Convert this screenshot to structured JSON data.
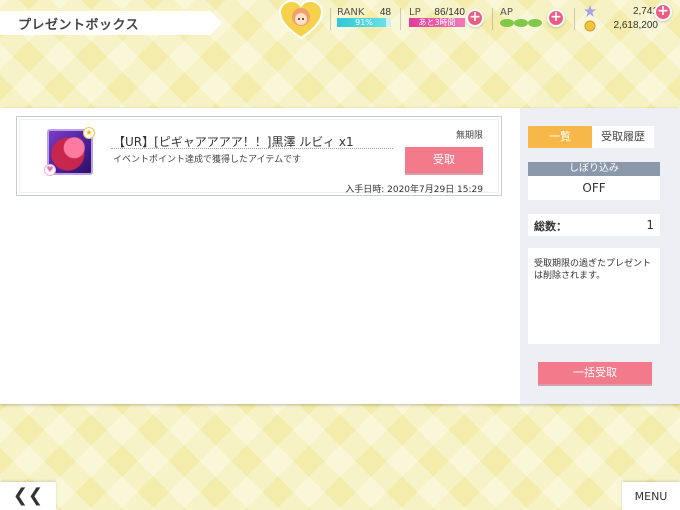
{
  "header": {
    "title": "プレゼントボックス",
    "rank": {
      "label": "RANK",
      "value": "48",
      "progress_text": "91%",
      "progress": 0.91
    },
    "lp": {
      "label": "LP",
      "value": "86/140",
      "sub": "あと3時間"
    },
    "ap": {
      "label": "AP"
    },
    "gems": {
      "stars": "2,741",
      "gold": "2,618,200"
    }
  },
  "gift_list": {
    "items": [
      {
        "title": "【UR】[ピギャアアアア！！]黒澤 ルビィ x1",
        "description": "イベントポイント達成で獲得したアイテムです",
        "expiry": "無期限",
        "receive_label": "受取",
        "date": "入手日時: 2020年7月29日 15:29"
      }
    ]
  },
  "sidebar": {
    "tabs": [
      "一覧",
      "受取履歴"
    ],
    "filter_label": "しぼり込み",
    "filter_value": "OFF",
    "count_label": "総数：",
    "count_value": "1",
    "notice": "受取期限の過ぎたプレゼントは削除されます。",
    "bulk_receive_label": "一括受取"
  },
  "footer": {
    "back_label": "❮❮",
    "menu_label": "MENU"
  },
  "colors": {
    "accent_pink": "#f27a8a",
    "tab_orange": "#f7b84a",
    "background_yellow": "#f3ecaa"
  }
}
